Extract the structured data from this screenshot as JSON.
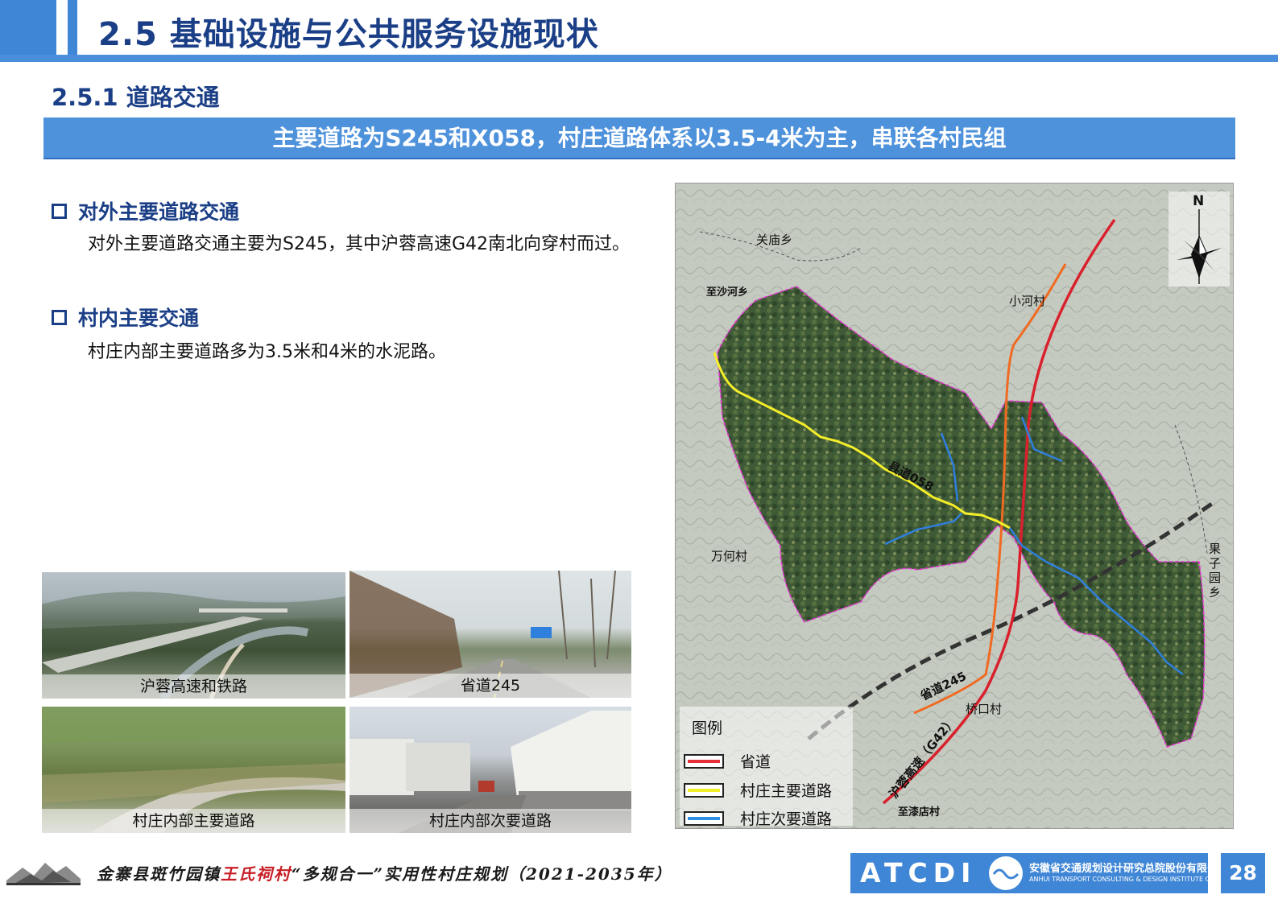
{
  "header": {
    "title": "2.5 基础设施与公共服务设施现状",
    "subsection": "2.5.1 道路交通",
    "banner": "主要道路为S245和X058，村庄道路体系以3.5-4米为主，串联各村民组"
  },
  "content": {
    "sections": [
      {
        "heading": "对外主要道路交通",
        "text": "对外主要道路交通主要为S245，其中沪蓉高速G42南北向穿村而过。"
      },
      {
        "heading": "村内主要交通",
        "text": "村庄内部主要道路多为3.5米和4米的水泥路。"
      }
    ]
  },
  "photos": [
    {
      "caption": "沪蓉高速和铁路"
    },
    {
      "caption": "省道245"
    },
    {
      "caption": "村庄内部主要道路"
    },
    {
      "caption": "村庄内部次要道路"
    }
  ],
  "map": {
    "north": "N",
    "places": {
      "guanmiao": "关庙乡",
      "shahe": "至沙河乡",
      "xiaohe": "小河村",
      "wanhe": "万何村",
      "guoziyuan": "果子园乡",
      "qiaokou": "桥口村",
      "qidian": "至漆店村"
    },
    "roads": {
      "county": "县道058",
      "provincial": "省道245",
      "expressway": "沪蓉高速（G42）"
    },
    "legend": {
      "title": "图例",
      "items": [
        {
          "label": "省道",
          "color": "#e5303a"
        },
        {
          "label": "村庄主要道路",
          "color": "#f3ee2a"
        },
        {
          "label": "村庄次要道路",
          "color": "#2f8fe4"
        }
      ]
    },
    "colors": {
      "expressway": "#d9212d",
      "provincial": "#f06a21",
      "main_road": "#f3ee2a",
      "secondary_road": "#2f7fdc",
      "boundary": "#e23bd0",
      "railway": "#333333"
    }
  },
  "footer": {
    "plan_prefix": "金寨县斑竹园镇",
    "village": "王氏祠村",
    "plan_suffix": "“多规合一”实用性村庄规划（2021-2035年）",
    "logo": "ATCDI",
    "company_cn": "安徽省交通规划设计研究总院股份有限公司",
    "company_en": "ANHUI TRANSPORT CONSULTING & DESIGN INSTITUTE CO.,LTD.",
    "page": "28"
  }
}
